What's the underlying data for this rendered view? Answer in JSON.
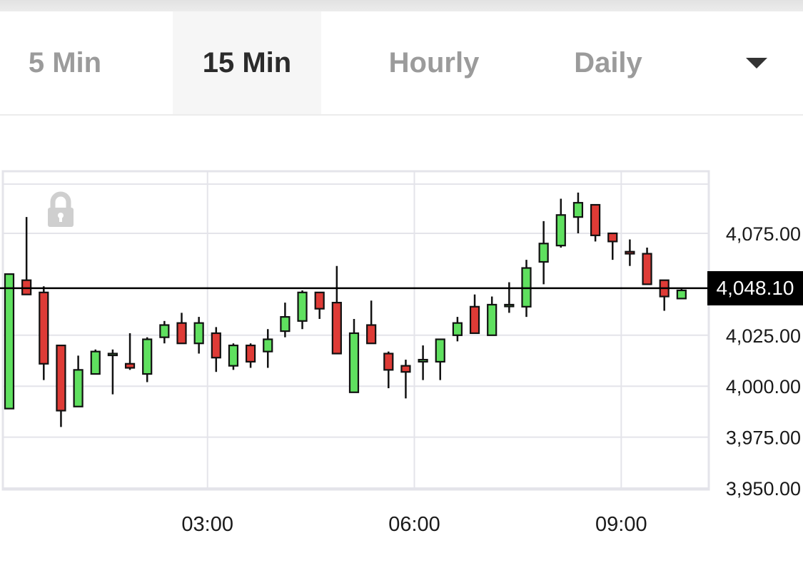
{
  "tabs": [
    {
      "label": "5 Min",
      "active": false
    },
    {
      "label": "15 Min",
      "active": true
    },
    {
      "label": "Hourly",
      "active": false
    },
    {
      "label": "Daily",
      "active": false
    }
  ],
  "dropdown_icon": "chevron-down-icon",
  "lock_icon": "lock-icon",
  "current_price_label": "4,048.10",
  "colors": {
    "up": "#5fe05f",
    "down": "#de3b36",
    "grid": "#e4e4ea",
    "price_line": "#000000"
  },
  "chart_data": {
    "type": "candlestick",
    "interval": "15 Min",
    "ylim": [
      3950,
      4090
    ],
    "y_ticks": [
      {
        "value": 4075,
        "label": "4,075.00"
      },
      {
        "value": 4025,
        "label": "4,025.00"
      },
      {
        "value": 4000,
        "label": "4,000.00"
      },
      {
        "value": 3975,
        "label": "3,975.00"
      },
      {
        "value": 3950,
        "label": "3,950.00"
      }
    ],
    "x_ticks": [
      {
        "index": 11.5,
        "label": "03:00"
      },
      {
        "index": 23.5,
        "label": "06:00"
      },
      {
        "index": 35.5,
        "label": "09:00"
      }
    ],
    "current_price": 4048.1,
    "candles": [
      {
        "o": 3989,
        "h": 4055,
        "l": 3989,
        "c": 4055
      },
      {
        "o": 4052,
        "h": 4083,
        "l": 4045,
        "c": 4045
      },
      {
        "o": 4046,
        "h": 4049,
        "l": 4003,
        "c": 4011
      },
      {
        "o": 4020,
        "h": 4020,
        "l": 3980,
        "c": 3988
      },
      {
        "o": 3990,
        "h": 4015,
        "l": 3990,
        "c": 4008
      },
      {
        "o": 4006,
        "h": 4018,
        "l": 4006,
        "c": 4017
      },
      {
        "o": 4016,
        "h": 4018,
        "l": 3996,
        "c": 4016
      },
      {
        "o": 4011,
        "h": 4026,
        "l": 4008,
        "c": 4009
      },
      {
        "o": 4006,
        "h": 4024,
        "l": 4002,
        "c": 4023
      },
      {
        "o": 4024,
        "h": 4032,
        "l": 4021,
        "c": 4030
      },
      {
        "o": 4031,
        "h": 4036,
        "l": 4021,
        "c": 4021
      },
      {
        "o": 4021,
        "h": 4034,
        "l": 4016,
        "c": 4031
      },
      {
        "o": 4026,
        "h": 4029,
        "l": 4007,
        "c": 4014
      },
      {
        "o": 4010,
        "h": 4021,
        "l": 4008,
        "c": 4020
      },
      {
        "o": 4020,
        "h": 4021,
        "l": 4009,
        "c": 4012
      },
      {
        "o": 4017,
        "h": 4028,
        "l": 4009,
        "c": 4023
      },
      {
        "o": 4027,
        "h": 4041,
        "l": 4024,
        "c": 4034
      },
      {
        "o": 4032,
        "h": 4047,
        "l": 4028,
        "c": 4046
      },
      {
        "o": 4046,
        "h": 4046,
        "l": 4033,
        "c": 4038
      },
      {
        "o": 4041,
        "h": 4059,
        "l": 4016,
        "c": 4016
      },
      {
        "o": 3997,
        "h": 4033,
        "l": 3997,
        "c": 4026
      },
      {
        "o": 4030,
        "h": 4042,
        "l": 4021,
        "c": 4021
      },
      {
        "o": 4016,
        "h": 4017,
        "l": 3999,
        "c": 4008
      },
      {
        "o": 4010,
        "h": 4013,
        "l": 3994,
        "c": 4007
      },
      {
        "o": 4012,
        "h": 4020,
        "l": 4003,
        "c": 4013
      },
      {
        "o": 4012,
        "h": 4023,
        "l": 4003,
        "c": 4023
      },
      {
        "o": 4025,
        "h": 4034,
        "l": 4022,
        "c": 4031
      },
      {
        "o": 4039,
        "h": 4045,
        "l": 4026,
        "c": 4026
      },
      {
        "o": 4025,
        "h": 4044,
        "l": 4025,
        "c": 4040
      },
      {
        "o": 4040,
        "h": 4051,
        "l": 4036,
        "c": 4040
      },
      {
        "o": 4039,
        "h": 4062,
        "l": 4034,
        "c": 4058
      },
      {
        "o": 4061,
        "h": 4081,
        "l": 4050,
        "c": 4070
      },
      {
        "o": 4069,
        "h": 4092,
        "l": 4068,
        "c": 4084
      },
      {
        "o": 4083,
        "h": 4095,
        "l": 4075,
        "c": 4090
      },
      {
        "o": 4089,
        "h": 4089,
        "l": 4071,
        "c": 4074
      },
      {
        "o": 4075,
        "h": 4075,
        "l": 4062,
        "c": 4071
      },
      {
        "o": 4066,
        "h": 4072,
        "l": 4059,
        "c": 4065
      },
      {
        "o": 4065,
        "h": 4068,
        "l": 4050,
        "c": 4050
      },
      {
        "o": 4052,
        "h": 4052,
        "l": 4037,
        "c": 4044
      },
      {
        "o": 4043,
        "h": 4048,
        "l": 4043,
        "c": 4047
      }
    ]
  }
}
